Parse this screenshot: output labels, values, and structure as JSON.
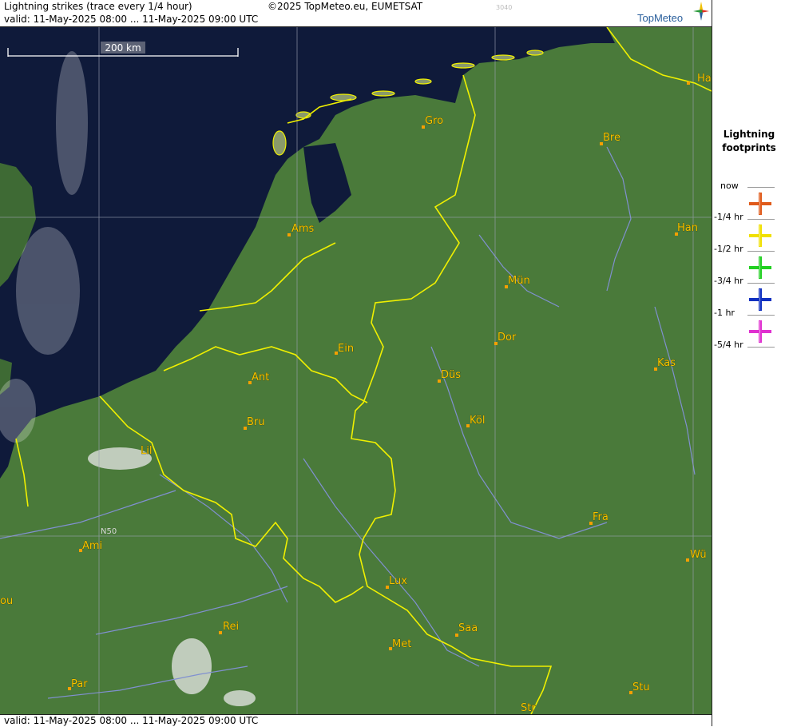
{
  "header": {
    "title": "Lightning strikes (trace every 1/4 hour)",
    "copyright": "©2025 TopMeteo.eu, EUMETSAT",
    "image_id": "3040",
    "valid": "valid:  11-May-2025 08:00 ... 11-May-2025 09:00 UTC",
    "logo": "TopMeteo"
  },
  "footer": {
    "valid": "valid:  11-May-2025 08:00 ... 11-May-2025 09:00 UTC"
  },
  "scale_bar": "200 km",
  "grid_label": "N50",
  "cities": {
    "gro": "Gro",
    "bre": "Bre",
    "ha": "Ha",
    "ams": "Ams",
    "han": "Han",
    "mun": "Mün",
    "dor": "Dor",
    "ein": "Ein",
    "kas": "Kas",
    "ant": "Ant",
    "dus": "Düs",
    "bru": "Bru",
    "kol": "Köl",
    "lil": "Lil",
    "fra": "Fra",
    "ami": "Ami",
    "wu": "Wü",
    "lux": "Lux",
    "ou": "ou",
    "rei": "Rei",
    "saa": "Saa",
    "met": "Met",
    "par": "Par",
    "stu": "Stu",
    "str": "Str"
  },
  "legend": {
    "title_line1": "Lightning",
    "title_line2": "footprints",
    "items": [
      {
        "label": "now",
        "color": "#e05a1a"
      },
      {
        "label": "-1/4 hr",
        "color": "#f0e000"
      },
      {
        "label": "-1/2 hr",
        "color": "#22d022"
      },
      {
        "label": "-3/4 hr",
        "color": "#1030c0"
      },
      {
        "label": "-1 hr",
        "color": "#e030d0"
      },
      {
        "label": "-5/4 hr",
        "color": ""
      }
    ]
  },
  "colors": {
    "sea": "#0f1a3a",
    "land": "#4a7a3a",
    "border": "#f0f000",
    "river": "#8090d0",
    "grid": "#9aa0b0",
    "label": "#f5c400"
  }
}
